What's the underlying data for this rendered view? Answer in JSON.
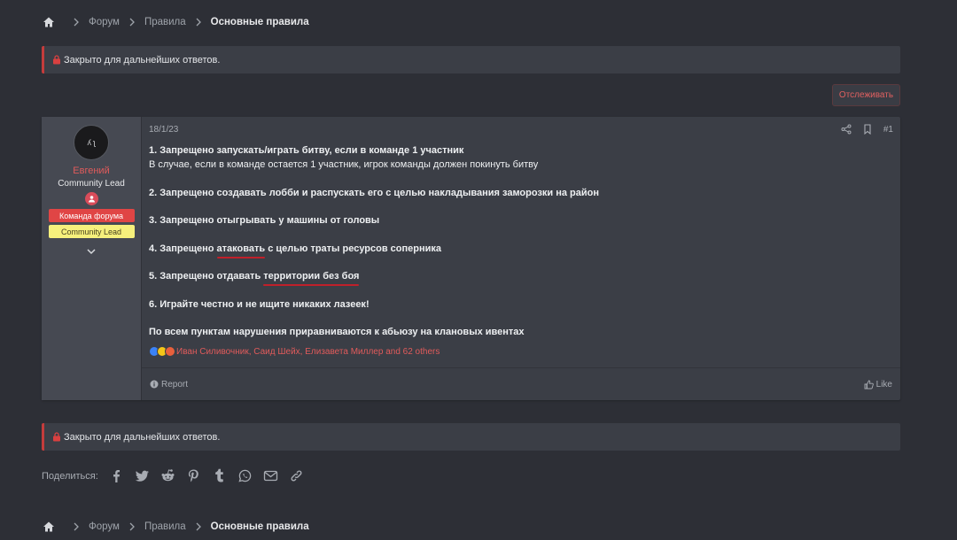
{
  "breadcrumb": {
    "items": [
      "Форум",
      "Правила"
    ],
    "current": "Основные правила"
  },
  "notice_text": "Закрыто для дальнейших ответов.",
  "watch_button": "Отслеживать",
  "post": {
    "user": {
      "avatar_text": "ʎ ʅ",
      "name": "Евгений",
      "title": "Community Lead",
      "banner_red": "Команда форума",
      "banner_yellow": "Community Lead"
    },
    "date": "18/1/23",
    "number": "#1",
    "lines": {
      "l1": "1. Запрещено запускать/играть битву, если в команде 1 участник",
      "l2": "В случае, если в команде остается 1 участник, игрок команды должен покинуть битву",
      "l3": "2. Запрещено создавать лобби и распускать его с целью накладывания заморозки на район",
      "l4": "3. Запрещено отыгрывать у машины от головы",
      "l5a": "4. Запрещено ",
      "l5b": "атаковать",
      "l5c": " с целью траты ресурсов соперника",
      "l6a": "5. Запрещено отдавать ",
      "l6b": "территории без боя",
      "l7": "6. Играйте честно и не ищите никаких лазеек!",
      "l8": "По всем пунктам нарушения приравниваются к абьюзу на клановых ивентах"
    },
    "reactions_text": "Иван Силивочник, Саид Шейх, Елизавета Миллер and 62 others",
    "report_label": "Report",
    "like_label": "Like"
  },
  "share_label": "Поделиться:",
  "icons": [
    "home-icon",
    "chevron-right-icon",
    "lock-icon",
    "share-icon",
    "bookmark-icon",
    "chevron-down-icon",
    "info-icon",
    "thumbs-up-icon",
    "facebook-icon",
    "twitter-icon",
    "reddit-icon",
    "pinterest-icon",
    "tumblr-icon",
    "whatsapp-icon",
    "email-icon",
    "link-icon"
  ],
  "colors": {
    "accent_red": "#e15b5b",
    "banner_red": "#e04545",
    "banner_yellow": "#f6f07c"
  }
}
